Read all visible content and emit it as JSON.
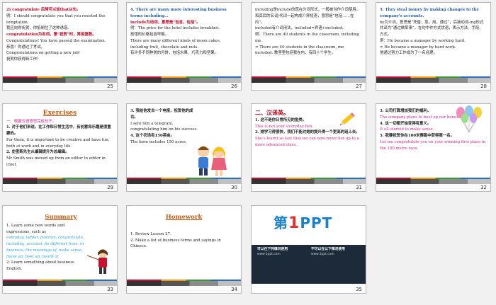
{
  "slides": [
    {
      "num": "25",
      "lines": [
        {
          "t": "2) congratulate 后常可以加that从句。",
          "c": "red"
        },
        {
          "t": "例：I should congratulate you that you resisted the temptation.",
          "c": ""
        },
        {
          "t": "我应向你祝贺，你抵制住了这种诱惑。",
          "c": ""
        },
        {
          "t": "congratulation为名词，意“祝贺”时，常用复数。",
          "c": "red"
        },
        {
          "t": "Congratulations! You have passed the examination.",
          "c": ""
        },
        {
          "t": "恭喜！你通过了考试。",
          "c": ""
        },
        {
          "t": "Congratulations on getting a new job!",
          "c": ""
        },
        {
          "t": "祝贺你获得新工作！",
          "c": ""
        }
      ]
    },
    {
      "num": "26",
      "lines": [
        {
          "t": "4. There are many more interesting business terms including…",
          "c": "blue"
        },
        {
          "t": "include为动词，意思是“包含，包括”。",
          "c": "red"
        },
        {
          "t": "例：The price for the hotel includes breakfast.",
          "c": ""
        },
        {
          "t": "旅馆的价格包括早餐。",
          "c": ""
        },
        {
          "t": "There are many different kinds of moon cakes, including fruit, chocolate and nuts.",
          "c": ""
        },
        {
          "t": "有许多不同种类的月饼，包括水果、巧克力和坚果。",
          "c": ""
        }
      ]
    },
    {
      "num": "27",
      "lines": [
        {
          "t": "including是include的现在分词形式，一般被当作介词使用，和其后的名词/代词一起构成介宾短语，意思是“包括……在内”。",
          "c": ""
        },
        {
          "t": "included有介词用法，included=宾语+included。",
          "c": ""
        },
        {
          "t": "例：There are 40 students in the classroom, including me.",
          "c": ""
        },
        {
          "t": "= There are 40 students in the classroom, me included. 教室里包括我在内，有四十个学生。",
          "c": ""
        }
      ]
    },
    {
      "num": "28",
      "lines": [
        {
          "t": "5. They steal money by making changes to the company's accounts.",
          "c": "blue"
        },
        {
          "t": "by为介词，意思是“凭借，靠，用，通过”，后接动词-ing形式并译为“通过做某事”，在句中作方式状语，表示方法、手段、方式。",
          "c": ""
        },
        {
          "t": "例：He became a manager by working hard.",
          "c": ""
        },
        {
          "t": "= He became a manager by hard work.",
          "c": ""
        },
        {
          "t": "他通过努力工作成为了一名经理。",
          "c": ""
        }
      ]
    },
    {
      "num": "29",
      "heading": "Exercises",
      "lines": [
        {
          "t": "一、根据汉语意思完成句子。",
          "c": "magenta"
        },
        {
          "t": "1. 对于他们来说，在工作和日常生活中，有创意和乐趣是很重要的。",
          "c": "bold"
        },
        {
          "t": "For them, it is important to be creative and have fun, both at work and in everyday life.",
          "c": ""
        },
        {
          "t": "2. 史密斯先生从编辑提升为总编辑。",
          "c": "bold"
        },
        {
          "t": "Mr Smith was moved up from an editor to editor in chief.",
          "c": ""
        }
      ]
    },
    {
      "num": "30",
      "lines": [
        {
          "t": "3. 我给他发去一个电报，祝贺他的成功。",
          "c": "bold"
        },
        {
          "t": "I sent him a telegram, congratulating him on his success.",
          "c": ""
        },
        {
          "t": "4. 这个农场有150英亩。",
          "c": "bold"
        },
        {
          "t": "The farm includes 150 acres.",
          "c": ""
        }
      ]
    },
    {
      "num": "31",
      "lines": [
        {
          "t": "二、汉译英。",
          "c": "red"
        },
        {
          "t": "1. 这不是你日常所见的鱼类。",
          "c": "bold"
        },
        {
          "t": "This is not your everyday fish.",
          "c": "magenta"
        },
        {
          "t": "2. 她学习得很快，我们不能对她的提升得一个更高的班上去。",
          "c": "bold"
        },
        {
          "t": "She's learnt so fast that we can now move her up to a more advanced class.",
          "c": "magenta"
        }
      ]
    },
    {
      "num": "32",
      "lines": [
        {
          "t": "3. 公司打算增加我们的福利。",
          "c": "bold"
        },
        {
          "t": "The company plans to beef up our benefits.",
          "c": "magenta"
        },
        {
          "t": "4. 这一切都开始变得有意义。",
          "c": "bold"
        },
        {
          "t": "It all started to make sense.",
          "c": "magenta"
        },
        {
          "t": "5. 我要祝贺你在100米赛跑中获得第一名。",
          "c": "bold"
        },
        {
          "t": "Let me congratulate you on your winning first place in the 100 metre race.",
          "c": "magenta"
        }
      ]
    },
    {
      "num": "33",
      "heading": "Summary",
      "lines": [
        {
          "t": "1. Learn some new words and expressions, such as",
          "c": ""
        },
        {
          "t": "everyday, ladder, position, congratulate, including, account, be different from, in business, the meanings of, make sense, move up, beef up, heard of",
          "c": "cyan"
        },
        {
          "t": "2. Learn something about business English.",
          "c": ""
        }
      ]
    },
    {
      "num": "34",
      "heading": "Homework",
      "lines": [
        {
          "t": "1. Review Lesson 27.",
          "c": ""
        },
        {
          "t": "2. Make a list of business terms and sayings in Chinese.",
          "c": ""
        }
      ]
    },
    {
      "num": "35",
      "cover": {
        "logo_prefix": "第",
        "logo_one": "1",
        "logo_suffix": "PPT",
        "col1_head": "可以在下列情况使用",
        "col1_text": "www.1ppt.com",
        "col2_head": "不可以在以下情况使用",
        "col2_text": "www.1ppt.com"
      }
    }
  ]
}
